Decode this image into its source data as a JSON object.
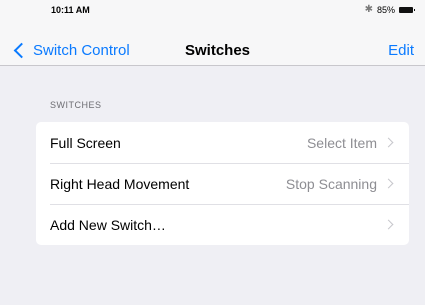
{
  "status_bar": {
    "time": "10:11 AM",
    "battery": "85%",
    "bluetooth_icon": "bluetooth-icon",
    "battery_icon": "battery-icon"
  },
  "nav": {
    "back_label": "Switch Control",
    "title": "Switches",
    "edit_label": "Edit"
  },
  "section": {
    "header": "SWITCHES",
    "rows": [
      {
        "label": "Full Screen",
        "value": "Select Item"
      },
      {
        "label": "Right Head Movement",
        "value": "Stop Scanning"
      },
      {
        "label": "Add New Switch…",
        "value": ""
      }
    ]
  },
  "colors": {
    "accent": "#0a7aff",
    "background": "#efeff4",
    "secondary_text": "#8e8e93"
  }
}
